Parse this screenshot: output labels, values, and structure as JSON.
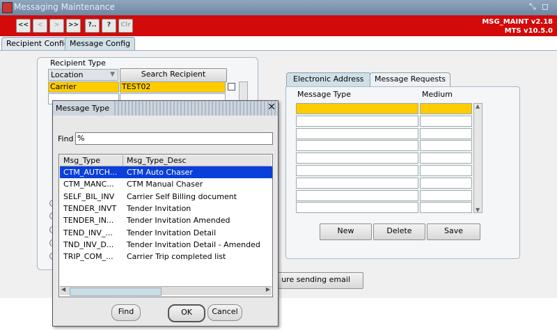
{
  "window": {
    "title": "Messaging Maintenance"
  },
  "toolbar": {
    "buttons": [
      "<<",
      "<",
      ">",
      ">>",
      "?..",
      "?",
      "Clr"
    ],
    "version_line1": "MSG_MAINT v2.18",
    "version_line2": "MTS v10.5.0"
  },
  "tabs": [
    "Recipient Config",
    "Message Config"
  ],
  "recipient": {
    "group_label": "Recipient Type",
    "location_label": "Location",
    "search_button": "Search Recipient",
    "row1_type": "Carrier",
    "row1_value": "TEST02"
  },
  "right_panel": {
    "tabs": [
      "Electronic Address",
      "Message Requests"
    ],
    "col_message_type": "Message Type",
    "col_medium": "Medium",
    "buttons": [
      "New",
      "Delete",
      "Save"
    ]
  },
  "background_button_partial": "ure sending email",
  "dialog": {
    "title": "Message Type",
    "find_label": "Find",
    "find_value": "%",
    "col1": "Msg_Type",
    "col2": "Msg_Type_Desc",
    "rows": [
      {
        "type": "CTM_AUTCH...",
        "desc": "CTM Auto Chaser"
      },
      {
        "type": "CTM_MANC...",
        "desc": "CTM Manual Chaser"
      },
      {
        "type": "SELF_BIL_INV",
        "desc": "Carrier Self Billing document"
      },
      {
        "type": "TENDER_INVT",
        "desc": "Tender Invitation"
      },
      {
        "type": "TENDER_IN...",
        "desc": "Tender Invitation Amended"
      },
      {
        "type": "TEND_INV_...",
        "desc": "Tender Invitation Detail"
      },
      {
        "type": "TND_INV_D...",
        "desc": "Tender Invitation Detail - Amended"
      },
      {
        "type": "TRIP_COM_...",
        "desc": "Carrier Trip completed list"
      }
    ],
    "selected_index": 0,
    "buttons": {
      "find": "Find",
      "ok": "OK",
      "cancel": "Cancel"
    }
  }
}
